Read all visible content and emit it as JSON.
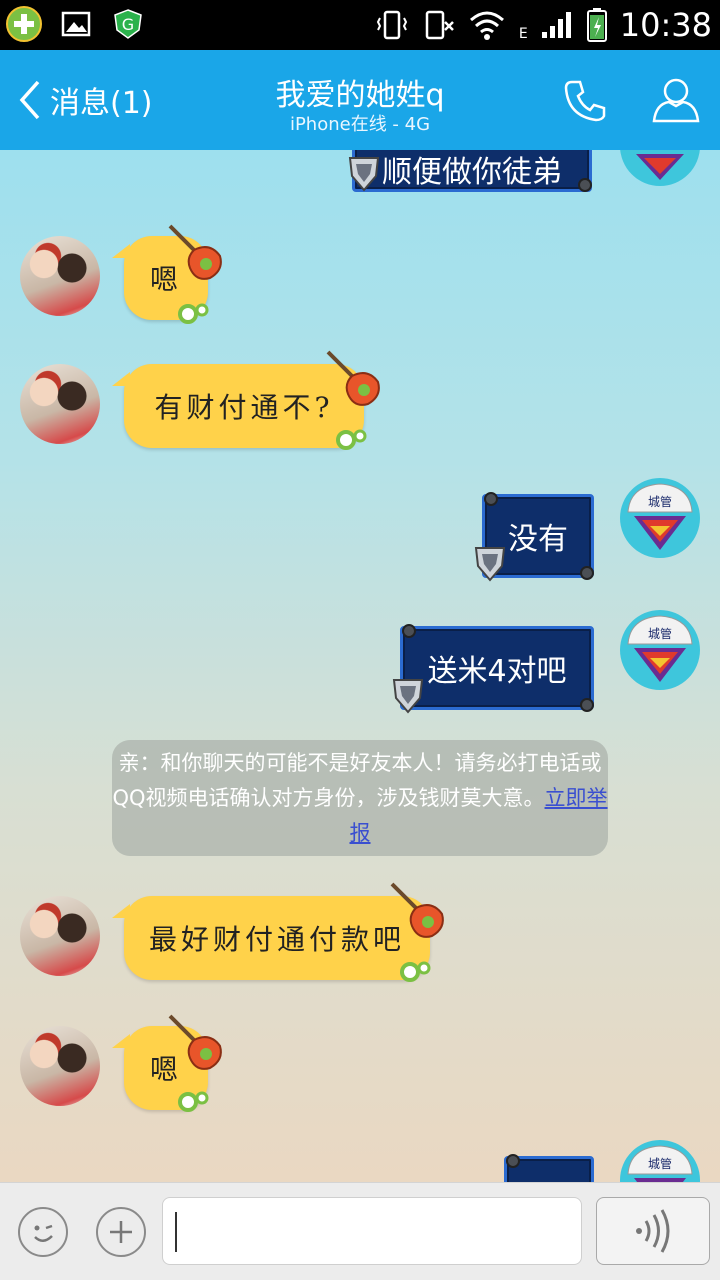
{
  "status_bar": {
    "time": "10:38",
    "network": "E"
  },
  "header": {
    "back_label": "消息(1)",
    "title": "我爱的她姓q",
    "subtitle": "iPhone在线 - 4G"
  },
  "messages": [
    {
      "side": "right",
      "style": "blue",
      "text": "顺便做你徒弟"
    },
    {
      "side": "left",
      "style": "yellow",
      "text": "嗯"
    },
    {
      "side": "left",
      "style": "yellow",
      "text": "有财付通不?"
    },
    {
      "side": "right",
      "style": "blue",
      "text": "没有"
    },
    {
      "side": "right",
      "style": "blue",
      "text": "送米4对吧"
    },
    {
      "side": "left",
      "style": "yellow",
      "text": "最好财付通付款吧"
    },
    {
      "side": "left",
      "style": "yellow",
      "text": "嗯"
    }
  ],
  "notice": {
    "text": "亲：和你聊天的可能不是好友本人！请务必打电话或QQ视频电话确认对方身份，涉及钱财莫大意。",
    "link": "立即举报"
  },
  "avatar_right_label": "城管",
  "colors": {
    "header": "#1aa6e8",
    "yellow_bubble": "#ffd24a",
    "blue_bubble": "#0e2e6a"
  }
}
